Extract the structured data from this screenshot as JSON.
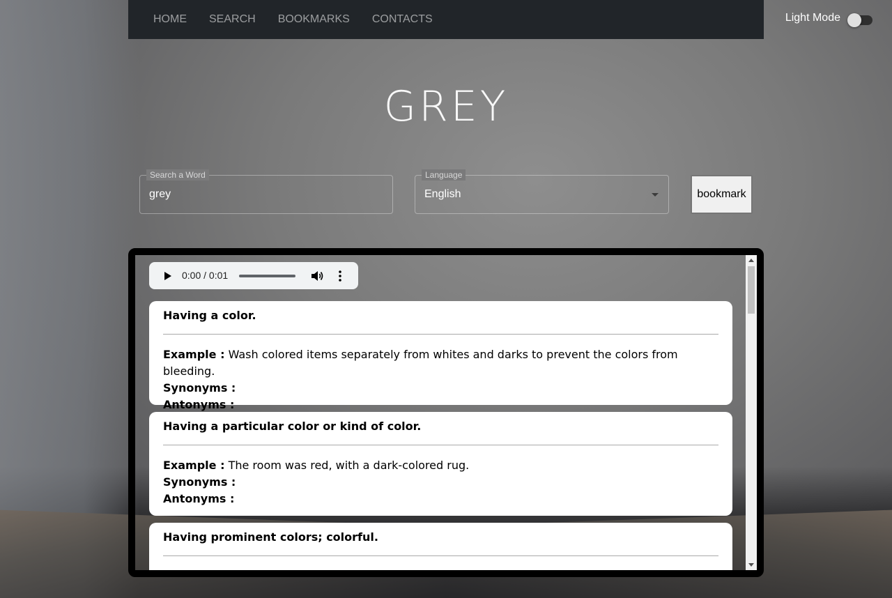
{
  "nav": {
    "links": [
      "HOME",
      "SEARCH",
      "BOOKMARKS",
      "CONTACTS"
    ],
    "theme_label": "Light Mode"
  },
  "title": "GREY",
  "search": {
    "label": "Search a Word",
    "value": "grey"
  },
  "language": {
    "label": "Language",
    "value": "English"
  },
  "bookmark_label": "bookmark",
  "audio": {
    "time": "0:00 / 0:01"
  },
  "definitions": [
    {
      "definition": "Having a color.",
      "example_label": "Example :",
      "example": "Wash colored items separately from whites and darks to prevent the colors from bleeding.",
      "synonyms_label": "Synonyms :",
      "antonyms_label": "Antonyms :"
    },
    {
      "definition": "Having a particular color or kind of color.",
      "example_label": "Example :",
      "example": "The room was red, with a dark-colored rug.",
      "synonyms_label": "Synonyms :",
      "antonyms_label": "Antonyms :"
    },
    {
      "definition": "Having prominent colors; colorful."
    }
  ]
}
